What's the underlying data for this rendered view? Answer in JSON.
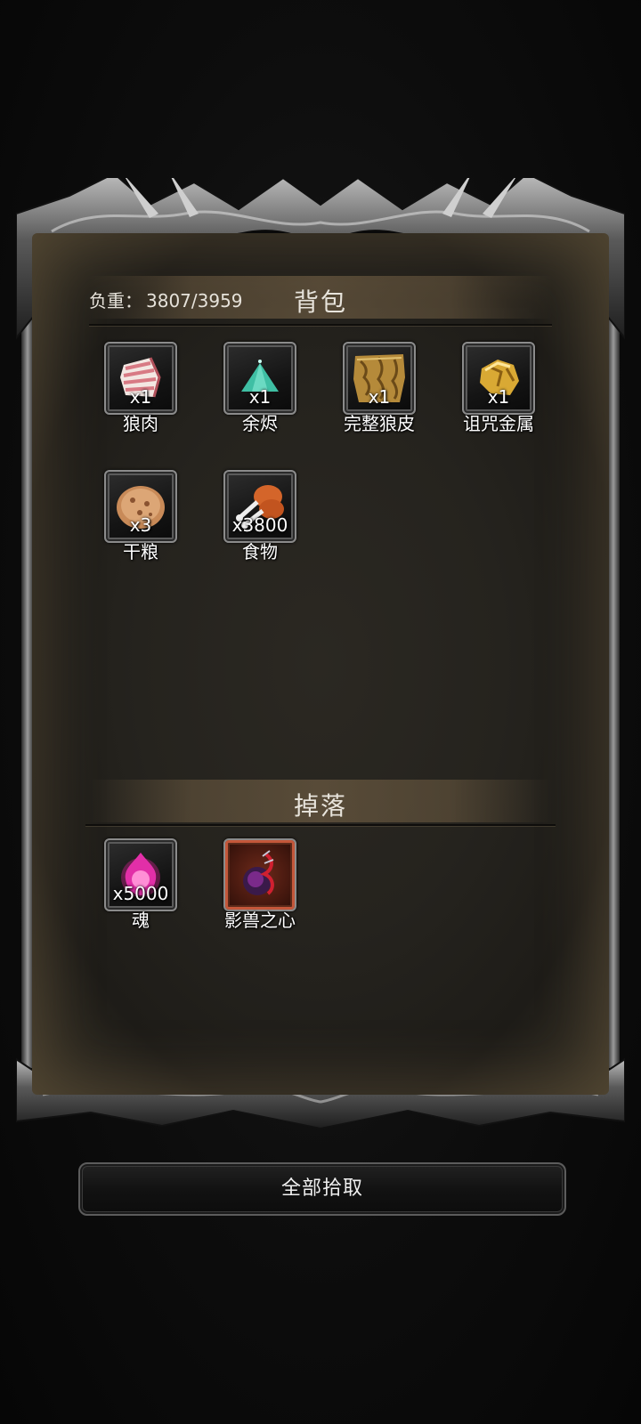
{
  "backpack": {
    "title": "背包",
    "weight_label": "负重：",
    "weight_value": "3807/3959",
    "items": [
      {
        "name": "狼肉",
        "count": "x1",
        "icon": "meat-icon"
      },
      {
        "name": "余烬",
        "count": "x1",
        "icon": "ember-icon"
      },
      {
        "name": "完整狼皮",
        "count": "x1",
        "icon": "wolf-pelt-icon"
      },
      {
        "name": "诅咒金属",
        "count": "x1",
        "icon": "cursed-metal-icon"
      },
      {
        "name": "干粮",
        "count": "x3",
        "icon": "ration-icon"
      },
      {
        "name": "食物",
        "count": "x3800",
        "icon": "drumstick-icon"
      }
    ]
  },
  "drops": {
    "title": "掉落",
    "items": [
      {
        "name": "魂",
        "count": "x5000",
        "icon": "soul-icon"
      },
      {
        "name": "影兽之心",
        "count": "",
        "icon": "shadow-beast-heart-icon"
      }
    ]
  },
  "pickup_all_button": "全部拾取"
}
